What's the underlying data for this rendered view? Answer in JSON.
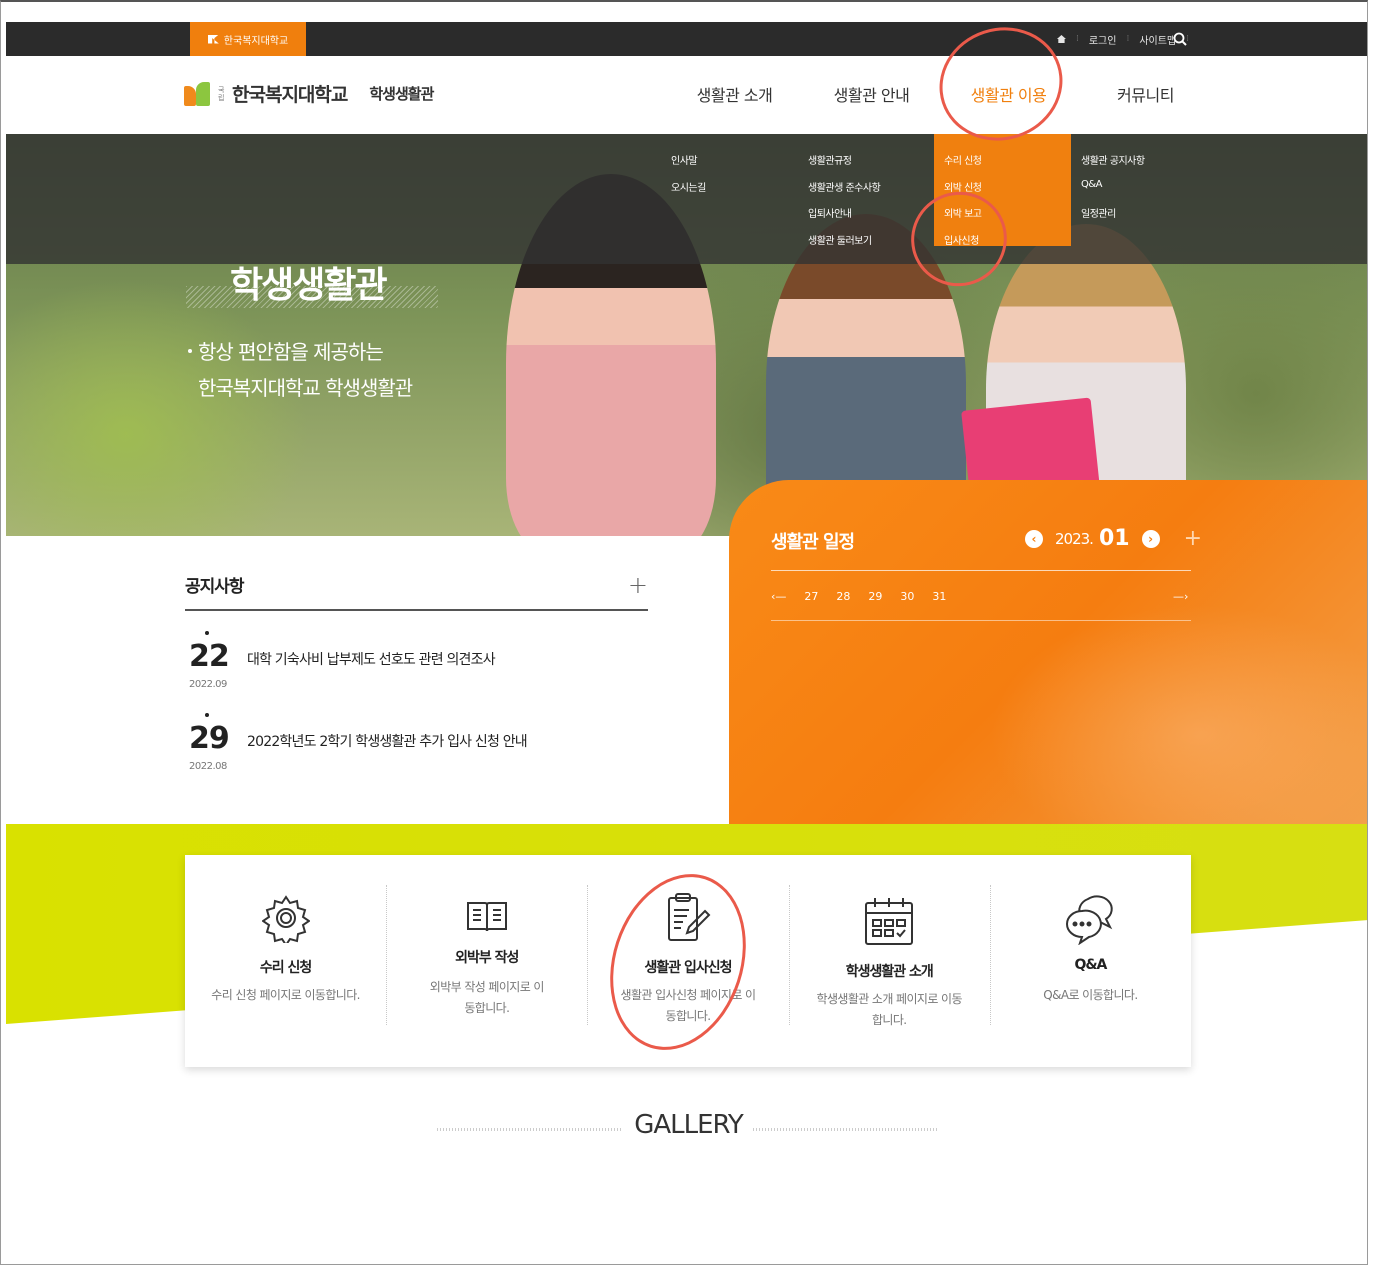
{
  "topbar": {
    "university_tab": "한국복지대학교",
    "links": [
      "홈",
      "로그인",
      "사이트맵"
    ]
  },
  "header": {
    "logo_sub": "국립",
    "logo_name": "한국복지대학교",
    "site_name": "학생생활관",
    "gnb": [
      "생활관 소개",
      "생활관 안내",
      "생활관 이용",
      "커뮤니티"
    ],
    "active_index": 2
  },
  "submenu": {
    "col1": [
      "인사말",
      "오시는길"
    ],
    "col2": [
      "생활관규정",
      "생활관생 준수사항",
      "입퇴사안내",
      "생활관 둘러보기"
    ],
    "col3": [
      "수리 신청",
      "외박 신청",
      "외박 보고",
      "입사신청"
    ],
    "col4": [
      "생활관 공지사항",
      "Q&A",
      "일정관리"
    ]
  },
  "hero": {
    "title": "학생생활관",
    "desc_line1": "항상 편안함을 제공하는",
    "desc_line2": "한국복지대학교 학생생활관"
  },
  "notice": {
    "title": "공지사항",
    "items": [
      {
        "day": "22",
        "ym": "2022.09",
        "text": "대학 기숙사비 납부제도 선호도 관련 의견조사"
      },
      {
        "day": "29",
        "ym": "2022.08",
        "text": "2022학년도 2학기 학생생활관 추가 입사 신청 안내"
      }
    ]
  },
  "schedule": {
    "title": "생활관 일정",
    "year": "2023.",
    "month": "01",
    "days": [
      "27",
      "28",
      "29",
      "30",
      "31"
    ]
  },
  "quick": [
    {
      "title": "수리 신청",
      "desc": "수리 신청 페이지로 이동합니다.",
      "icon": "gear-icon"
    },
    {
      "title": "외박부 작성",
      "desc": "외박부 작성 페이지로 이동합니다.",
      "icon": "book-icon"
    },
    {
      "title": "생활관 입사신청",
      "desc": "생활관 입사신청 페이지로 이동합니다.",
      "icon": "clipboard-edit-icon"
    },
    {
      "title": "학생생활관 소개",
      "desc": "학생생활관 소개 페이지로 이동합니다.",
      "icon": "calendar-icon"
    },
    {
      "title": "Q&A",
      "desc": "Q&A로 이동합니다.",
      "icon": "chat-bubbles-icon"
    }
  ],
  "gallery": {
    "title": "GALLERY"
  },
  "colors": {
    "accent": "#f07f0d",
    "band": "#d9e100",
    "annotation": "#ea5a4a"
  }
}
